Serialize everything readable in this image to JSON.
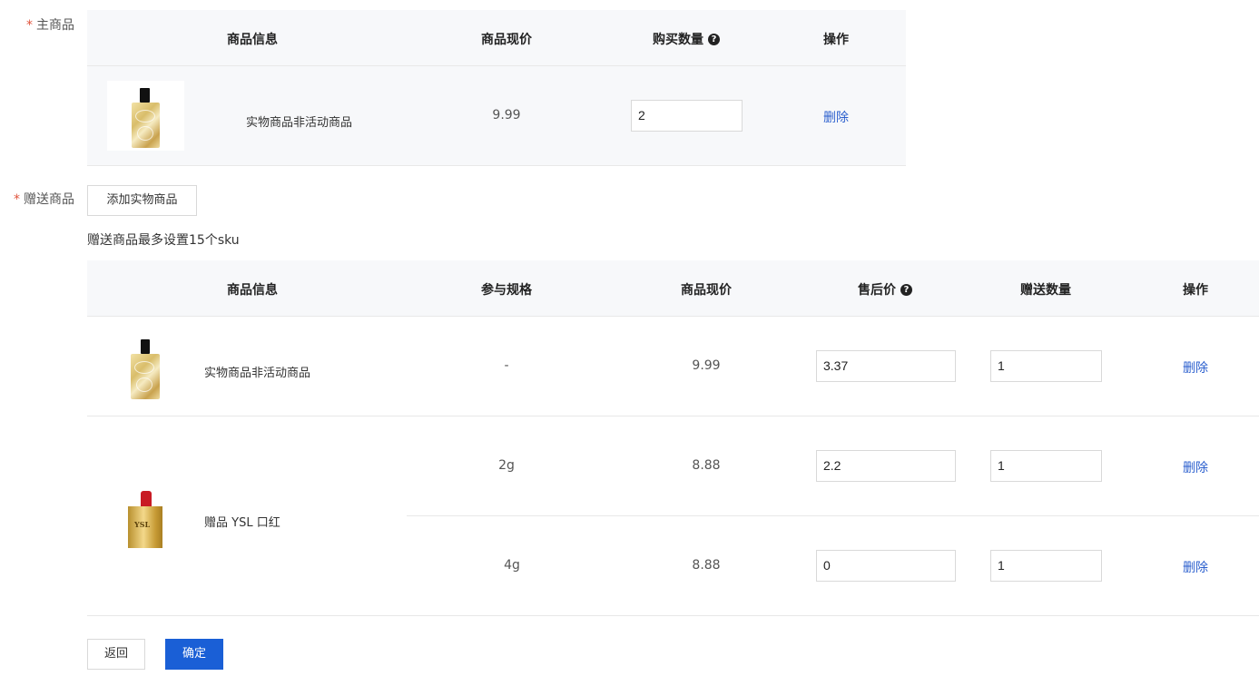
{
  "main_section": {
    "required_mark": "*",
    "label": "主商品",
    "columns": {
      "info": "商品信息",
      "price": "商品现价",
      "qty": "购买数量",
      "action": "操作"
    },
    "help_icon": "question-circle-icon",
    "row": {
      "image": "perfume-bottle",
      "name": "实物商品非活动商品",
      "price": "9.99",
      "qty": "2",
      "action": "删除"
    }
  },
  "gift_section": {
    "required_mark": "*",
    "label": "赠送商品",
    "add_button": "添加实物商品",
    "hint": "赠送商品最多设置15个sku",
    "columns": {
      "info": "商品信息",
      "spec": "参与规格",
      "price": "商品现价",
      "after_price": "售后价",
      "qty": "赠送数量",
      "action": "操作"
    },
    "rows": [
      {
        "image": "perfume-bottle",
        "name": "实物商品非活动商品",
        "spec": "-",
        "price": "9.99",
        "after_price": "3.37",
        "qty": "1",
        "action": "删除"
      },
      {
        "image": "lipstick",
        "name": "赠品 YSL 口红",
        "lip_mark": "YSL",
        "spec": "2g",
        "price": "8.88",
        "after_price": "2.2",
        "qty": "1",
        "action": "删除"
      },
      {
        "spec": "4g",
        "price": "8.88",
        "after_price": "0",
        "qty": "1",
        "action": "删除"
      }
    ]
  },
  "footer": {
    "back_button": "返回",
    "confirm_button": "确定"
  },
  "colors": {
    "header_bg": "#f7f8fa",
    "primary": "#1a5fd6",
    "link": "#2b5fce",
    "required": "#e0533c"
  }
}
